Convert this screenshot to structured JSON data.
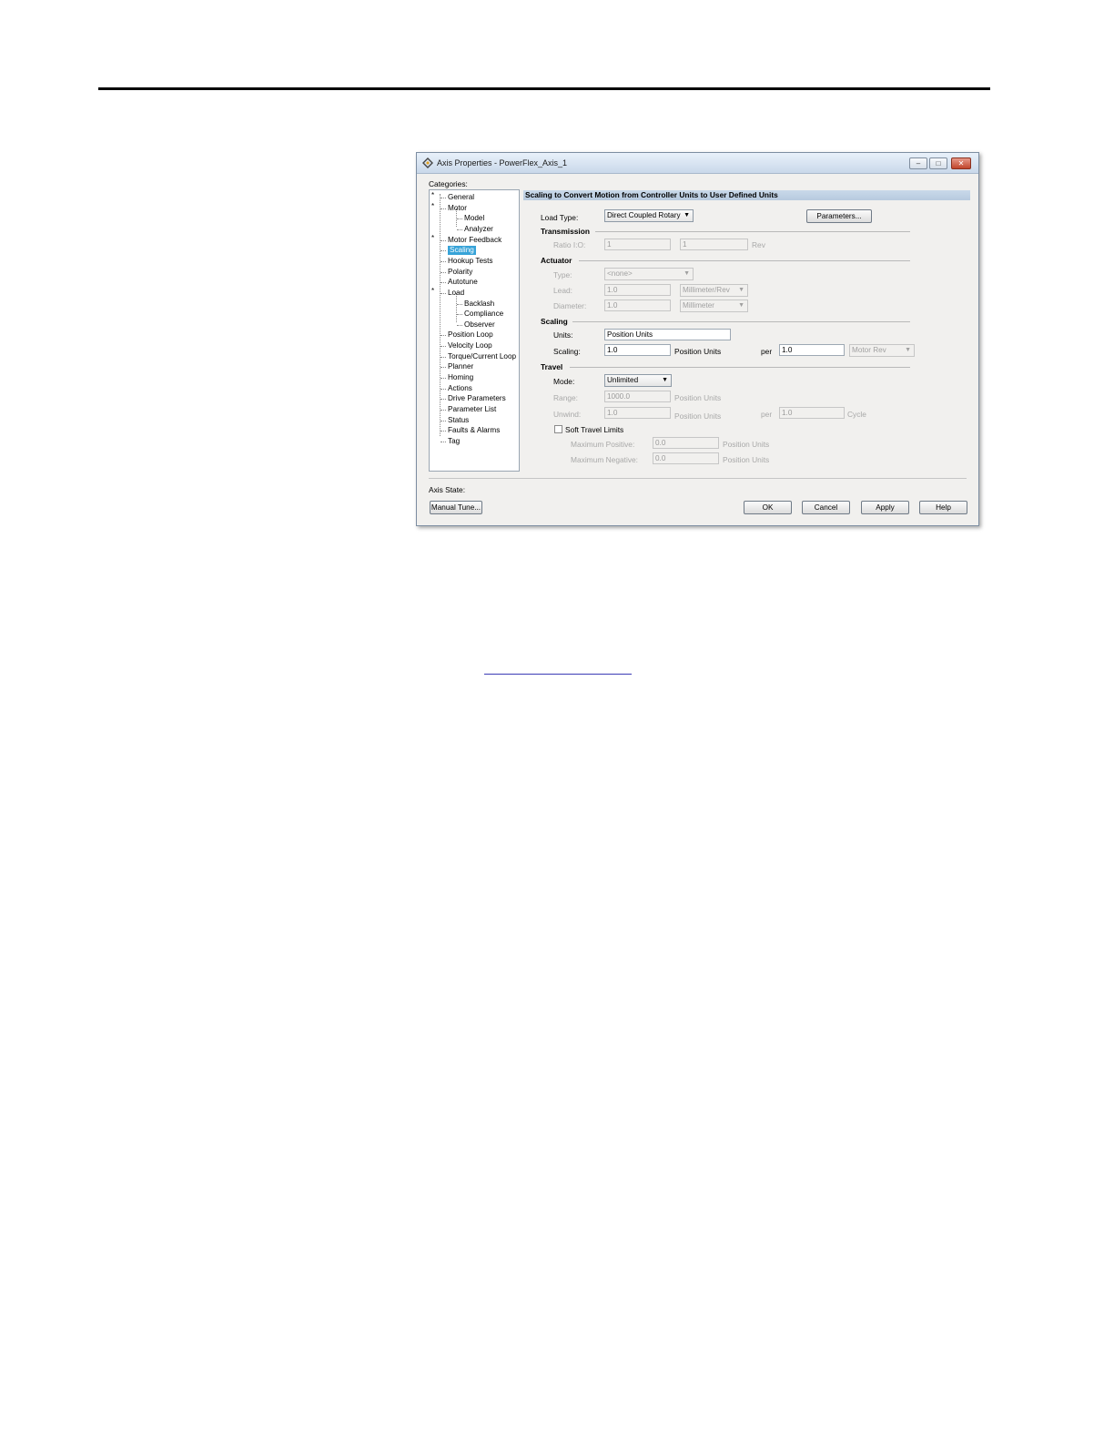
{
  "window": {
    "title": "Axis Properties - PowerFlex_Axis_1",
    "controls": {
      "minimize": "–",
      "maximize": "□",
      "close": "✕"
    }
  },
  "categories_label": "Categories:",
  "tree": [
    {
      "label": "General",
      "starred": true
    },
    {
      "label": "Motor",
      "starred": true
    },
    {
      "label": "Model"
    },
    {
      "label": "Analyzer"
    },
    {
      "label": "Motor Feedback",
      "starred": true
    },
    {
      "label": "Scaling",
      "selected": true
    },
    {
      "label": "Hookup Tests"
    },
    {
      "label": "Polarity"
    },
    {
      "label": "Autotune"
    },
    {
      "label": "Load",
      "starred": true
    },
    {
      "label": "Backlash"
    },
    {
      "label": "Compliance"
    },
    {
      "label": "Observer"
    },
    {
      "label": "Position Loop"
    },
    {
      "label": "Velocity Loop"
    },
    {
      "label": "Torque/Current Loop"
    },
    {
      "label": "Planner"
    },
    {
      "label": "Homing"
    },
    {
      "label": "Actions"
    },
    {
      "label": "Drive Parameters"
    },
    {
      "label": "Parameter List"
    },
    {
      "label": "Status"
    },
    {
      "label": "Faults & Alarms"
    },
    {
      "label": "Tag"
    }
  ],
  "star": "*",
  "section_title": "Scaling to Convert Motion from Controller Units to User Defined Units",
  "load_type": {
    "label": "Load Type:",
    "value": "Direct Coupled Rotary"
  },
  "parameters_button": "Parameters...",
  "transmission": {
    "title": "Transmission",
    "ratio_label": "Ratio I:O:",
    "ratio_in": "1",
    "ratio_out": "1",
    "unit": "Rev"
  },
  "actuator": {
    "title": "Actuator",
    "type_label": "Type:",
    "type_value": "<none>",
    "lead_label": "Lead:",
    "lead_value": "1.0",
    "lead_unit": "Millimeter/Rev",
    "diameter_label": "Diameter:",
    "diameter_value": "1.0",
    "diameter_unit": "Millimeter"
  },
  "scaling": {
    "title": "Scaling",
    "units_label": "Units:",
    "units_value": "Position Units",
    "scaling_label": "Scaling:",
    "scaling_value": "1.0",
    "scaling_unit": "Position Units",
    "per_label": "per",
    "per_value": "1.0",
    "per_unit": "Motor Rev"
  },
  "travel": {
    "title": "Travel",
    "mode_label": "Mode:",
    "mode_value": "Unlimited",
    "range_label": "Range:",
    "range_value": "1000.0",
    "range_unit": "Position Units",
    "unwind_label": "Unwind:",
    "unwind_value": "1.0",
    "unwind_unit": "Position Units",
    "unwind_per_label": "per",
    "unwind_per_value": "1.0",
    "cycle_label": "Cycle",
    "soft_limits_label": "Soft Travel Limits",
    "max_pos_label": "Maximum Positive:",
    "max_pos_value": "0.0",
    "max_pos_unit": "Position Units",
    "max_neg_label": "Maximum Negative:",
    "max_neg_value": "0.0",
    "max_neg_unit": "Position Units"
  },
  "axis_state_label": "Axis State:",
  "buttons": {
    "manual_tune": "Manual Tune...",
    "ok": "OK",
    "cancel": "Cancel",
    "apply": "Apply",
    "help": "Help"
  },
  "dropdown_arrow": "▼"
}
